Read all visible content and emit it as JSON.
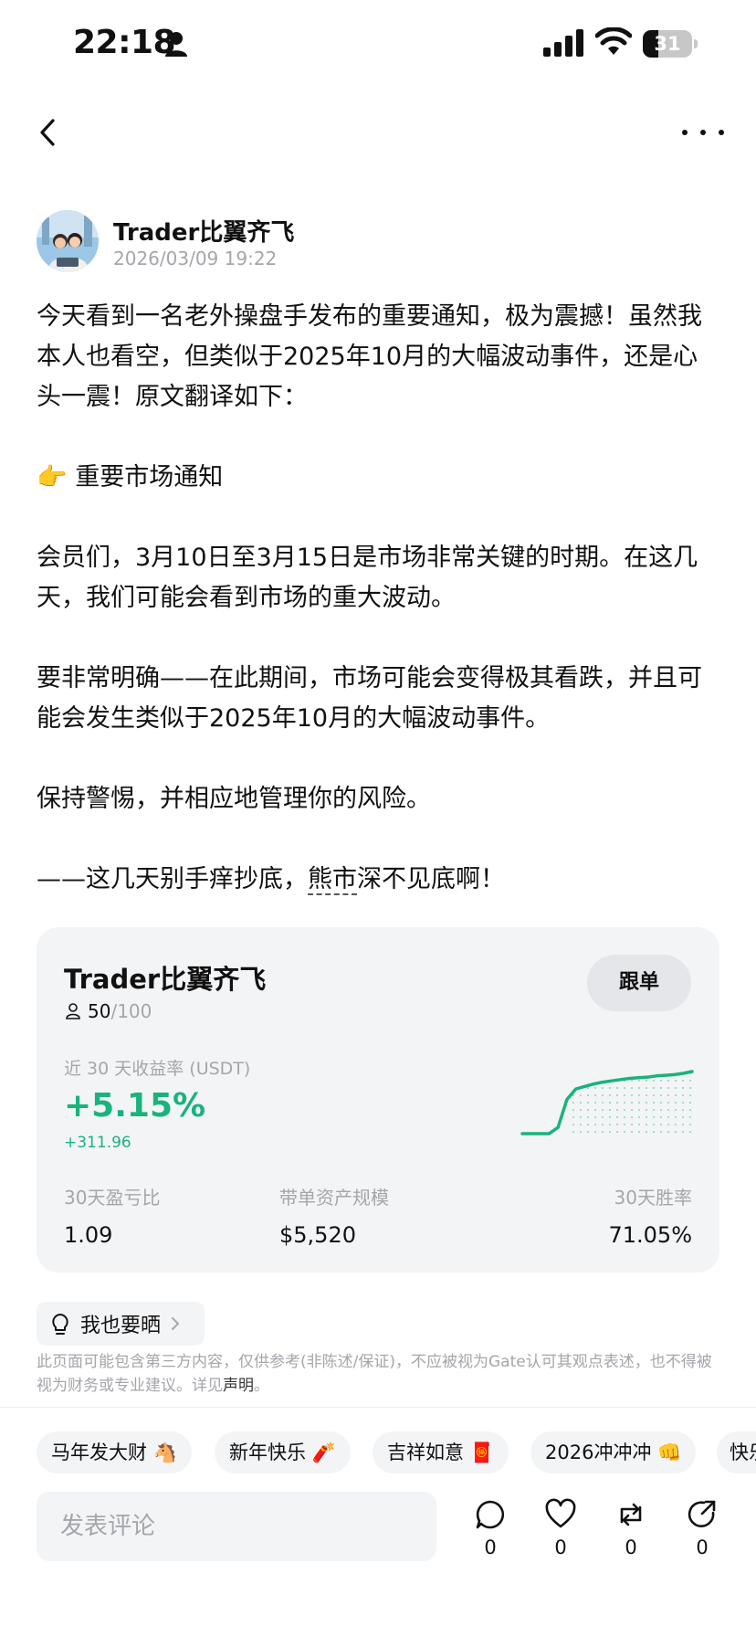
{
  "status_bar": {
    "time": "22:18",
    "battery": "31",
    "battery_level": 0.31
  },
  "nav": {
    "back_icon": "chevron-left-icon",
    "more_icon": "more-horizontal-icon"
  },
  "author": {
    "name": "Trader比翼齐飞",
    "timestamp": "2026/03/09 19:22",
    "avatar_icon": "avatar-photo"
  },
  "post": {
    "p1": "今天看到一名老外操盘手发布的重要通知，极为震撼！虽然我本人也看空，但类似于2025年10月的大幅波动事件，还是心头一震！原文翻译如下：",
    "p2_emoji": "👉",
    "p2": "重要市场通知",
    "p3": "会员们，3月10日至3月15日是市场非常关键的时期。在这几天，我们可能会看到市场的重大波动。",
    "p4": "要非常明确——在此期间，市场可能会变得极其看跌，并且可能会发生类似于2025年10月的大幅波动事件。",
    "p5": "保持警惕，并相应地管理你的风险。",
    "p6_a": "——这几天别手痒抄底，",
    "p6_link": "熊市",
    "p6_b": "深不见底啊！"
  },
  "trader_card": {
    "name": "Trader比翼齐飞",
    "followers": "50",
    "followers_max": "/100",
    "follow_label": "跟单",
    "roi_label": "近 30 天收益率 (USDT)",
    "roi_pct": "+5.15%",
    "roi_abs": "+311.96",
    "stats": [
      {
        "label": "30天盈亏比",
        "value": "1.09"
      },
      {
        "label": "带单资产规模",
        "value": "$5,520"
      },
      {
        "label": "30天胜率",
        "value": "71.05%"
      }
    ],
    "accent_color": "#19b37b",
    "sparkline": [
      0,
      0,
      0,
      0,
      0.1,
      0.55,
      0.72,
      0.76,
      0.8,
      0.83,
      0.85,
      0.87,
      0.89,
      0.9,
      0.91,
      0.93,
      0.94,
      0.95,
      0.97,
      1.0
    ]
  },
  "share": {
    "label": "我也要晒",
    "icon": "lightbulb-icon"
  },
  "disclaimer": {
    "text": "此页面可能包含第三方内容，仅供参考(非陈述/保证)，不应被视为Gate认可其观点表述，也不得被视为财务或专业建议。详见",
    "link": "声明",
    "end": "。"
  },
  "chips": [
    "马年发大财 🐴",
    "新年快乐 🧨",
    "吉祥如意 🧧",
    "2026冲冲冲 👊",
    "快乐"
  ],
  "comment": {
    "placeholder": "发表评论"
  },
  "actions": [
    {
      "icon": "comment-icon",
      "count": "0"
    },
    {
      "icon": "heart-icon",
      "count": "0"
    },
    {
      "icon": "repost-icon",
      "count": "0"
    },
    {
      "icon": "share-icon",
      "count": "0"
    }
  ]
}
